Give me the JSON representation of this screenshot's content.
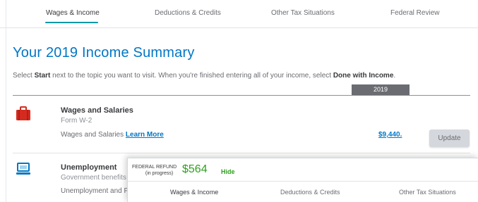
{
  "top_nav": {
    "tabs": [
      {
        "label": "Wages & Income",
        "active": true
      },
      {
        "label": "Deductions & Credits",
        "active": false
      },
      {
        "label": "Other Tax Situations",
        "active": false
      },
      {
        "label": "Federal Review",
        "active": false
      }
    ]
  },
  "main": {
    "title": "Your 2019 Income Summary",
    "intro": {
      "pre": "Select ",
      "start": "Start",
      "mid": " next to the topic you want to visit. When you're finished entering all of your income, select ",
      "done": "Done with Income",
      "post": "."
    },
    "year_column": "2019",
    "rows": [
      {
        "icon": "briefcase-icon",
        "title": "Wages and Salaries",
        "subtitle": "Form W-2",
        "description": "Wages and Salaries ",
        "learn_more": "Learn More",
        "amount": "$9,440.",
        "button": "Update"
      },
      {
        "icon": "laptop-icon",
        "title": "Unemployment",
        "subtitle": "Government benefits",
        "description": "Unemployment and F"
      }
    ]
  },
  "refund_panel": {
    "label_line1": "FEDERAL REFUND",
    "label_line2": "(in progress)",
    "amount": "$564",
    "hide": "Hide",
    "tabs": [
      {
        "label": "Wages & Income",
        "active": true
      },
      {
        "label": "Deductions & Credits",
        "active": false
      },
      {
        "label": "Other Tax Situations",
        "active": false
      }
    ]
  },
  "colors": {
    "accent_teal": "#0098a6",
    "link_blue": "#0077c5",
    "refund_green": "#2ca01c",
    "briefcase_red": "#d52b1e",
    "laptop_blue": "#0077c5"
  }
}
